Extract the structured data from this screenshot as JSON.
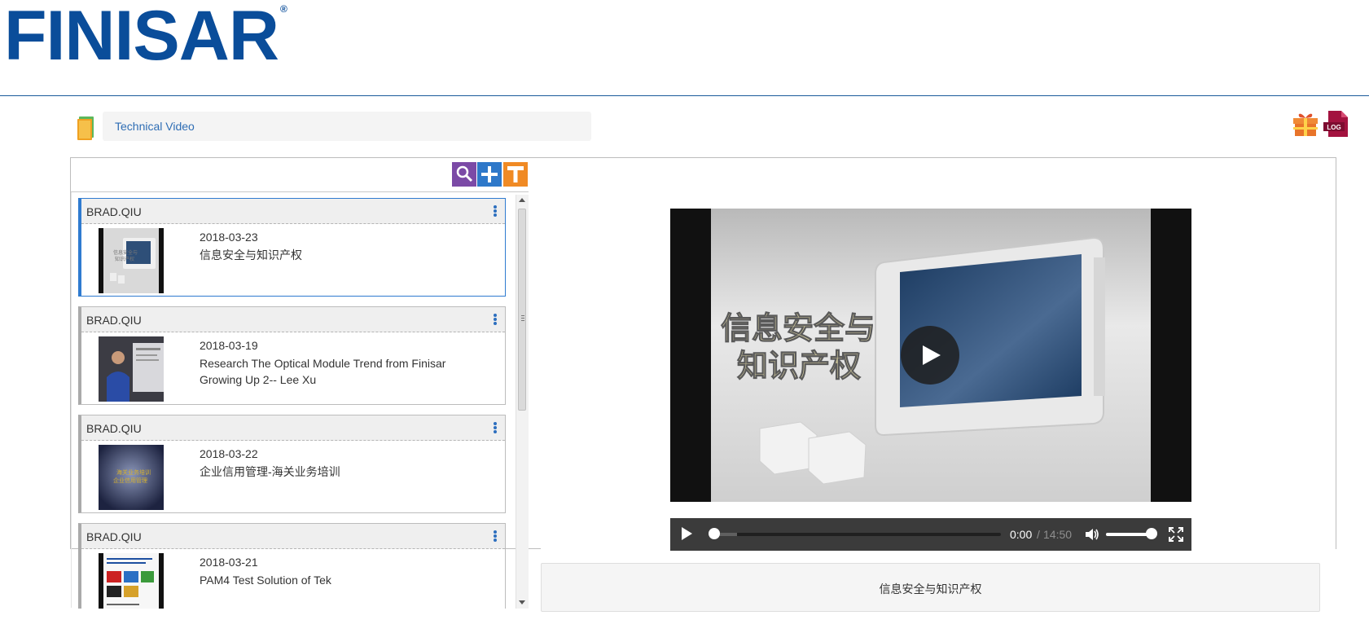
{
  "brand": {
    "logo_text": "FINISAR",
    "registered_mark": "®",
    "color": "#0a4d9a"
  },
  "breadcrumb": {
    "label": "Technical Video"
  },
  "toolbar": {
    "buttons": [
      {
        "icon": "search-icon",
        "color": "#7b4aa6"
      },
      {
        "icon": "plus-icon",
        "color": "#2e78c9"
      },
      {
        "icon": "text-t-icon",
        "color": "#f08a24"
      }
    ]
  },
  "header_actions": {
    "gift_icon": "gift-icon",
    "log_label": "LOG"
  },
  "video_list": [
    {
      "author": "BRAD.QIU",
      "date": "2018-03-23",
      "title": "信息安全与知识产权",
      "active": true,
      "thumb_text": "信息安全与知识产权"
    },
    {
      "author": "BRAD.QIU",
      "date": "2018-03-19",
      "title": "Research The Optical Module Trend from Finisar Growing Up 2-- Lee Xu",
      "active": false
    },
    {
      "author": "BRAD.QIU",
      "date": "2018-03-22",
      "title": "企业信用管理-海关业务培训",
      "active": false,
      "thumb_text": "海关业务培训 企业信用管理"
    },
    {
      "author": "BRAD.QIU",
      "date": "2018-03-21",
      "title": "PAM4 Test Solution of Tek",
      "active": false
    }
  ],
  "player": {
    "frame_title_line1": "信息安全与",
    "frame_title_line2": "知识产权",
    "current_time": "0:00",
    "separator": "/",
    "duration": "14:50",
    "progress": 0.0,
    "volume": 0.9
  },
  "caption": {
    "title": "信息安全与知识产权"
  }
}
